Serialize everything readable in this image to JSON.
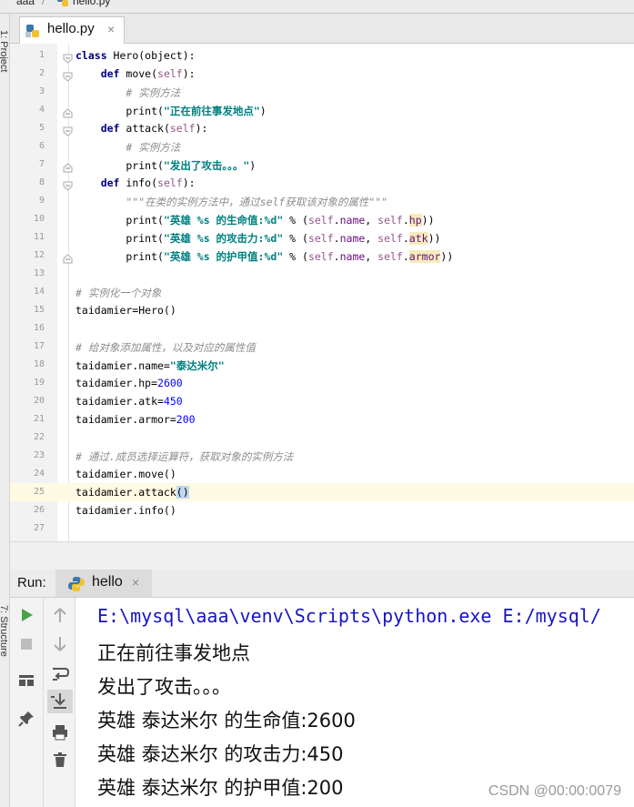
{
  "breadcrumb": {
    "folder": "aaa",
    "sep": "/",
    "file": "hello.py"
  },
  "side_panels": {
    "project": "1: Project",
    "structure": "7: Structure"
  },
  "editor": {
    "tab": {
      "label": "hello.py",
      "close": "×"
    },
    "current_line": 25,
    "lines": [
      {
        "n": "1",
        "html": "<span class='kw'>class</span> Hero(object):"
      },
      {
        "n": "2",
        "html": "    <span class='kw'>def</span> move(<span class='sf'>self</span>):"
      },
      {
        "n": "3",
        "html": "        <span class='cm'># 实例方法</span>"
      },
      {
        "n": "4",
        "html": "        print(<span class='st'>\"正在前往事发地点\"</span>)"
      },
      {
        "n": "5",
        "html": "    <span class='kw'>def</span> attack(<span class='sf'>self</span>):"
      },
      {
        "n": "6",
        "html": "        <span class='cm'># 实例方法</span>"
      },
      {
        "n": "7",
        "html": "        print(<span class='st'>\"发出了攻击。。。\"</span>)"
      },
      {
        "n": "8",
        "html": "    <span class='kw'>def</span> info(<span class='sf'>self</span>):"
      },
      {
        "n": "9",
        "html": "        <span class='cm'>\"\"\"在类的实例方法中，通过self获取该对象的属性\"\"\"</span>"
      },
      {
        "n": "10",
        "html": "        print(<span class='st'>\"英雄 %s 的生命值:%d\"</span> % (<span class='sf'>self</span>.<span class='at'>name</span>, <span class='sf'>self</span>.<span class='at hl'>hp</span>))"
      },
      {
        "n": "11",
        "html": "        print(<span class='st'>\"英雄 %s 的攻击力:%d\"</span> % (<span class='sf'>self</span>.<span class='at'>name</span>, <span class='sf'>self</span>.<span class='at hl'>atk</span>))"
      },
      {
        "n": "12",
        "html": "        print(<span class='st'>\"英雄 %s 的护甲值:%d\"</span> % (<span class='sf'>self</span>.<span class='at'>name</span>, <span class='sf'>self</span>.<span class='at hl'>armor</span>))"
      },
      {
        "n": "13",
        "html": ""
      },
      {
        "n": "14",
        "html": "<span class='cm'># 实例化一个对象</span>"
      },
      {
        "n": "15",
        "html": "taidamier=Hero()"
      },
      {
        "n": "16",
        "html": ""
      },
      {
        "n": "17",
        "html": "<span class='cm'># 给对象添加属性，以及对应的属性值</span>"
      },
      {
        "n": "18",
        "html": "taidamier.name=<span class='st'>\"泰达米尔\"</span>"
      },
      {
        "n": "19",
        "html": "taidamier.hp=<span class='nm'>2600</span>"
      },
      {
        "n": "20",
        "html": "taidamier.atk=<span class='nm'>450</span>"
      },
      {
        "n": "21",
        "html": "taidamier.armor=<span class='nm'>200</span>"
      },
      {
        "n": "22",
        "html": ""
      },
      {
        "n": "23",
        "html": "<span class='cm'># 通过.成员选择运算符，获取对象的实例方法</span>"
      },
      {
        "n": "24",
        "html": "taidamier.move()"
      },
      {
        "n": "25",
        "html": "taidamier.attack<span class='caret'>()</span>"
      },
      {
        "n": "26",
        "html": "taidamier.info()"
      },
      {
        "n": "27",
        "html": ""
      }
    ]
  },
  "run": {
    "label": "Run:",
    "tab": {
      "label": "hello",
      "close": "×"
    },
    "tool_icons_left": [
      "run-icon",
      "stop-icon",
      "layout-icon",
      "pin-icon"
    ],
    "tool_icons_right": [
      "up-arrow-icon",
      "down-arrow-icon",
      "soft-wrap-icon",
      "scroll-to-end-icon",
      "print-icon",
      "trash-icon"
    ],
    "console": [
      {
        "kind": "cmd",
        "text": "E:\\mysql\\aaa\\venv\\Scripts\\python.exe E:/mysql/"
      },
      {
        "kind": "out",
        "text": "正在前往事发地点"
      },
      {
        "kind": "out",
        "text": "发出了攻击。。。"
      },
      {
        "kind": "out",
        "text": "英雄 泰达米尔 的生命值:2600"
      },
      {
        "kind": "out",
        "text": "英雄 泰达米尔 的攻击力:450"
      },
      {
        "kind": "out",
        "text": "英雄 泰达米尔 的护甲值:200"
      }
    ]
  },
  "watermark": "CSDN @00:00:0079",
  "colors": {
    "keyword": "#000080",
    "string": "#008080",
    "number": "#0000ff",
    "comment": "#8c8c8c",
    "self": "#94558d",
    "current_line": "#fffae3"
  }
}
